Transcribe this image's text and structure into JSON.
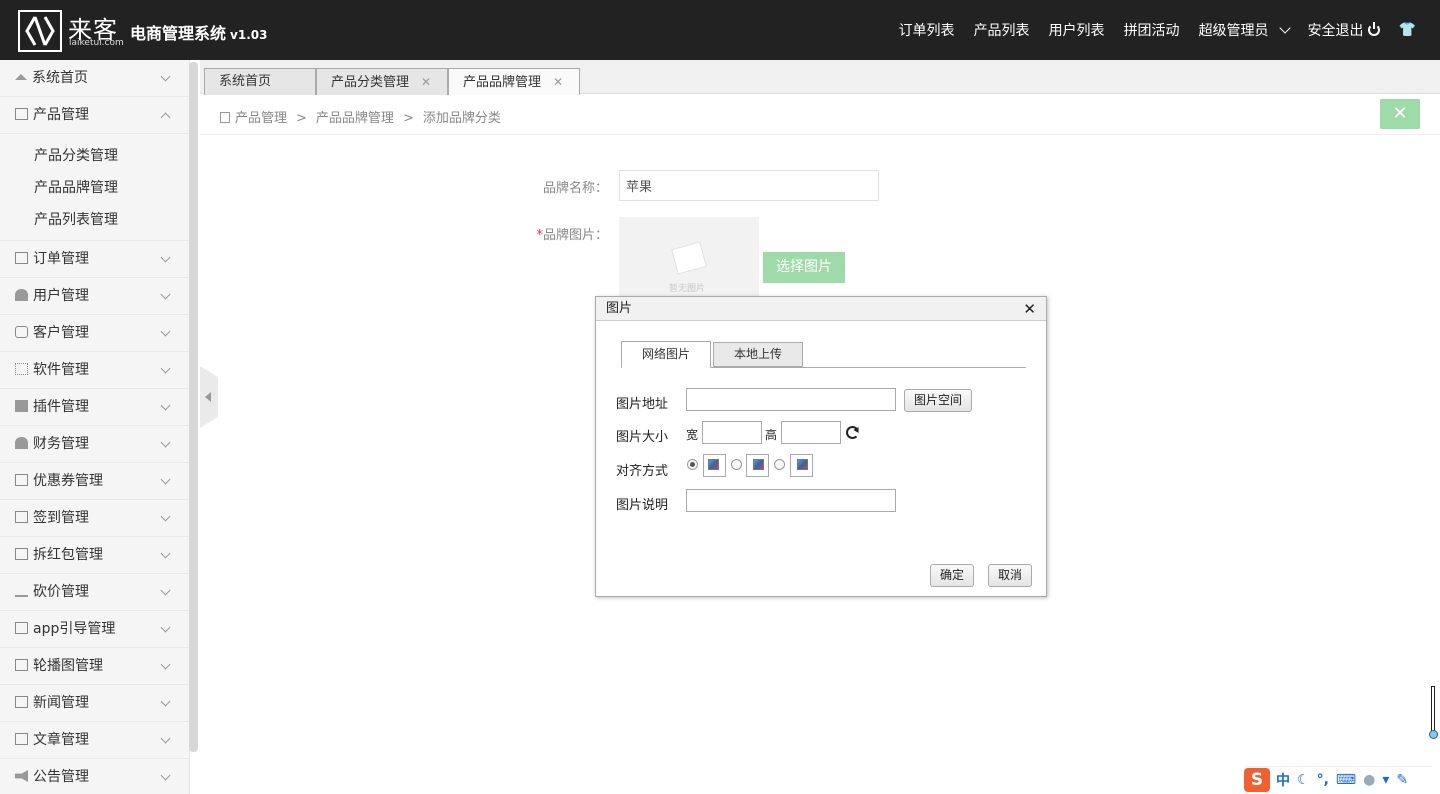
{
  "header": {
    "logo_cn": "来客",
    "logo_en": "laiketui.com",
    "title": "电商管理系统",
    "version": "v1.03",
    "nav": [
      "订单列表",
      "产品列表",
      "用户列表",
      "拼团活动",
      "超级管理员",
      "安全退出"
    ]
  },
  "sidebar": {
    "items": [
      {
        "label": "系统首页",
        "icon": "home-icon"
      },
      {
        "label": "产品管理",
        "icon": "bag-icon",
        "expanded": true,
        "children": [
          "产品分类管理",
          "产品品牌管理",
          "产品列表管理"
        ]
      },
      {
        "label": "订单管理",
        "icon": "list-icon"
      },
      {
        "label": "用户管理",
        "icon": "user-icon"
      },
      {
        "label": "客户管理",
        "icon": "customer-icon"
      },
      {
        "label": "软件管理",
        "icon": "grid-icon"
      },
      {
        "label": "插件管理",
        "icon": "puzzle-icon"
      },
      {
        "label": "财务管理",
        "icon": "finance-icon"
      },
      {
        "label": "优惠券管理",
        "icon": "coupon-icon"
      },
      {
        "label": "签到管理",
        "icon": "clipboard-icon"
      },
      {
        "label": "拆红包管理",
        "icon": "redpacket-icon"
      },
      {
        "label": "砍价管理",
        "icon": "bargain-icon"
      },
      {
        "label": "app引导管理",
        "icon": "image-icon"
      },
      {
        "label": "轮播图管理",
        "icon": "image-icon"
      },
      {
        "label": "新闻管理",
        "icon": "news-icon"
      },
      {
        "label": "文章管理",
        "icon": "document-icon"
      },
      {
        "label": "公告管理",
        "icon": "megaphone-icon"
      }
    ]
  },
  "tabs": [
    {
      "label": "系统首页",
      "closable": false,
      "active": false
    },
    {
      "label": "产品分类管理",
      "closable": true,
      "active": false
    },
    {
      "label": "产品品牌管理",
      "closable": true,
      "active": true
    }
  ],
  "breadcrumb": [
    "产品管理",
    "产品品牌管理",
    "添加品牌分类"
  ],
  "form": {
    "brand_name_label": "品牌名称：",
    "brand_name_value": "苹果",
    "brand_image_label": "品牌图片：",
    "required_mark": "*",
    "no_image_text": "暂无图片",
    "pick_image_button": "选择图片"
  },
  "dialog": {
    "title": "图片",
    "tabs": [
      "网络图片",
      "本地上传"
    ],
    "url_label": "图片地址",
    "url_value": "",
    "space_button": "图片空间",
    "size_label": "图片大小",
    "width_label": "宽",
    "height_label": "高",
    "align_label": "对齐方式",
    "desc_label": "图片说明",
    "ok_button": "确定",
    "cancel_button": "取消"
  },
  "ime": {
    "mode": "中"
  },
  "colors": {
    "header_bg": "#222222",
    "accent_green": "#9fdaa9"
  }
}
